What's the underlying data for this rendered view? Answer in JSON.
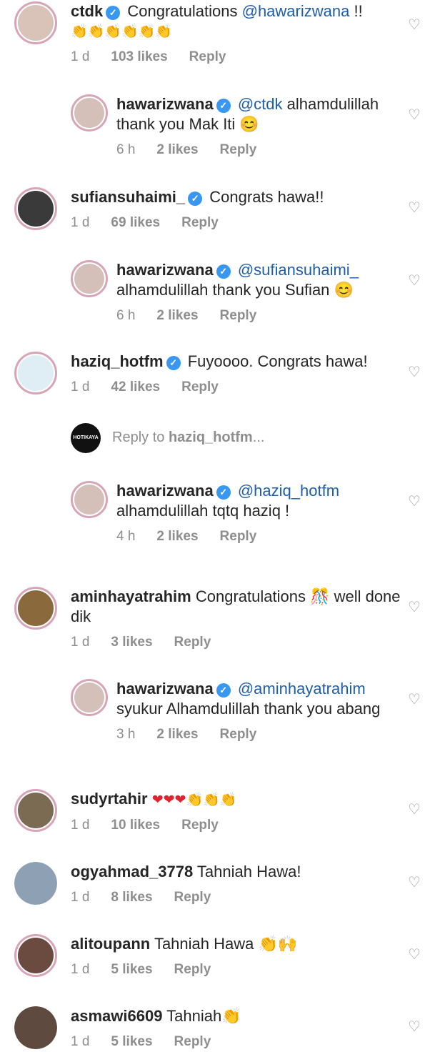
{
  "comments": [
    {
      "user": "ctdk",
      "verified": true,
      "pre": "",
      "mention": "",
      "text": "Congratulations",
      "mention2": "@hawarizwana",
      "suffix": " !!",
      "line2": "👏👏👏👏👏👏",
      "time": "1 d",
      "likes": "103 likes",
      "reply": "Reply"
    },
    {
      "user": "hawarizwana",
      "verified": true,
      "mention": "@ctdk",
      "text": "alhamdulillah thank you Mak Iti 😊",
      "time": "6 h",
      "likes": "2 likes",
      "reply": "Reply"
    },
    {
      "user": "sufiansuhaimi_",
      "verified": true,
      "text": "Congrats hawa!!",
      "time": "1 d",
      "likes": "69 likes",
      "reply": "Reply"
    },
    {
      "user": "hawarizwana",
      "verified": true,
      "mention": "@sufiansuhaimi_",
      "text": "alhamdulillah thank you Sufian 😊",
      "time": "6 h",
      "likes": "2 likes",
      "reply": "Reply"
    },
    {
      "user": "haziq_hotfm",
      "verified": true,
      "text": "Fuyoooo. Congrats hawa!",
      "time": "1 d",
      "likes": "42 likes",
      "reply": "Reply"
    },
    {
      "user": "hawarizwana",
      "verified": true,
      "mention": "@haziq_hotfm",
      "text": "alhamdulillah tqtq haziq !",
      "time": "4 h",
      "likes": "2 likes",
      "reply": "Reply"
    },
    {
      "user": "aminhayatrahim",
      "verified": false,
      "text": "Congratulations 🎊 well done dik",
      "time": "1 d",
      "likes": "3 likes",
      "reply": "Reply"
    },
    {
      "user": "hawarizwana",
      "verified": true,
      "mention": "@aminhayatrahim",
      "text": "syukur Alhamdulillah thank you abang",
      "time": "3 h",
      "likes": "2 likes",
      "reply": "Reply"
    },
    {
      "user": "sudyrtahir",
      "verified": false,
      "text": "❤❤❤👏👏👏",
      "time": "1 d",
      "likes": "10 likes",
      "reply": "Reply"
    },
    {
      "user": "ogyahmad_3778",
      "verified": false,
      "text": "Tahniah Hawa!",
      "time": "1 d",
      "likes": "8 likes",
      "reply": "Reply"
    },
    {
      "user": "alitoupann",
      "verified": false,
      "text": "Tahniah Hawa 👏🙌",
      "time": "1 d",
      "likes": "5 likes",
      "reply": "Reply"
    },
    {
      "user": "asmawi6609",
      "verified": false,
      "text": "Tahniah👏",
      "time": "1 d",
      "likes": "5 likes",
      "reply": "Reply"
    }
  ],
  "reply_composer": {
    "prefix": "Reply to",
    "target": "haziq_hotfm",
    "suffix": "...",
    "avatar_text": "HOTIKAYA"
  },
  "icons": {
    "like": "heart-outline-icon",
    "verified": "verified-badge-icon"
  },
  "colors": {
    "mention": "#1e5ea8",
    "verified": "#3897f0",
    "meta": "#8e8e8e"
  }
}
